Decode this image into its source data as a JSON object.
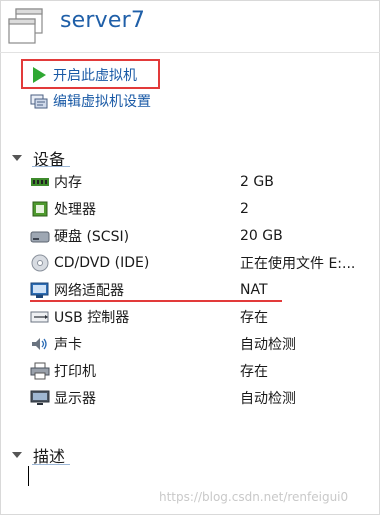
{
  "header": {
    "title": "server7"
  },
  "actions": {
    "power_on": "开启此虚拟机",
    "edit_settings": "编辑虚拟机设置"
  },
  "sections": {
    "devices": "设备",
    "description": "描述"
  },
  "devices": [
    {
      "name": "内存",
      "value": "2 GB",
      "icon": "memory-icon"
    },
    {
      "name": "处理器",
      "value": "2",
      "icon": "processor-icon"
    },
    {
      "name": "硬盘 (SCSI)",
      "value": "20 GB",
      "icon": "hard-disk-icon"
    },
    {
      "name": "CD/DVD (IDE)",
      "value": "正在使用文件 E:...",
      "icon": "cd-dvd-icon"
    },
    {
      "name": "网络适配器",
      "value": "NAT",
      "icon": "network-adapter-icon"
    },
    {
      "name": "USB 控制器",
      "value": "存在",
      "icon": "usb-icon"
    },
    {
      "name": "声卡",
      "value": "自动检测",
      "icon": "sound-card-icon"
    },
    {
      "name": "打印机",
      "value": "存在",
      "icon": "printer-icon"
    },
    {
      "name": "显示器",
      "value": "自动检测",
      "icon": "display-icon"
    }
  ],
  "watermark": "https://blog.csdn.net/renfeigui0",
  "colors": {
    "title": "#1f5fa8",
    "link": "#1a5aa6",
    "highlight": "#e23a3a",
    "play": "#2fa832"
  }
}
